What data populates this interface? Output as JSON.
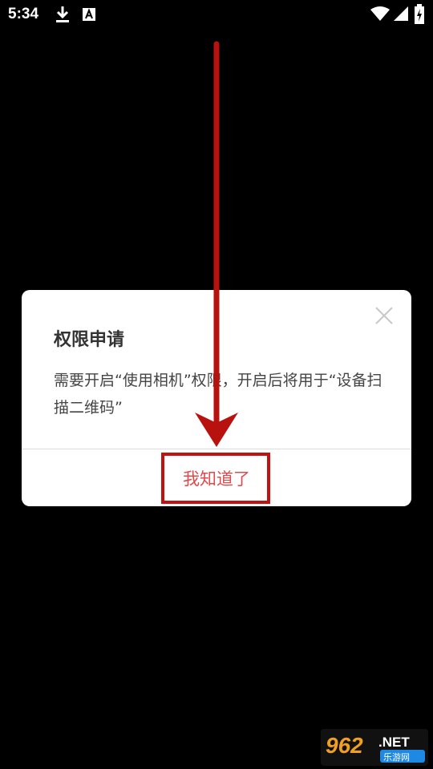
{
  "status_bar": {
    "time": "5:34",
    "icons": [
      "download-icon",
      "a-icon",
      "wifi-icon",
      "signal-icon",
      "battery-icon"
    ]
  },
  "dialog": {
    "title": "权限申请",
    "message": "需要开启“使用相机”权限，开启后将用于“设备扫描二维码”",
    "ok_label": "我知道了",
    "close_icon": "close-icon"
  },
  "annotation": {
    "arrow_icon": "arrow-down-icon",
    "color": "#c0130f"
  },
  "watermark": {
    "brand": "962.NET",
    "sub": "乐游网"
  },
  "colors": {
    "background": "#000000",
    "dialog_bg": "#ffffff",
    "accent_red": "#e04a4a"
  }
}
